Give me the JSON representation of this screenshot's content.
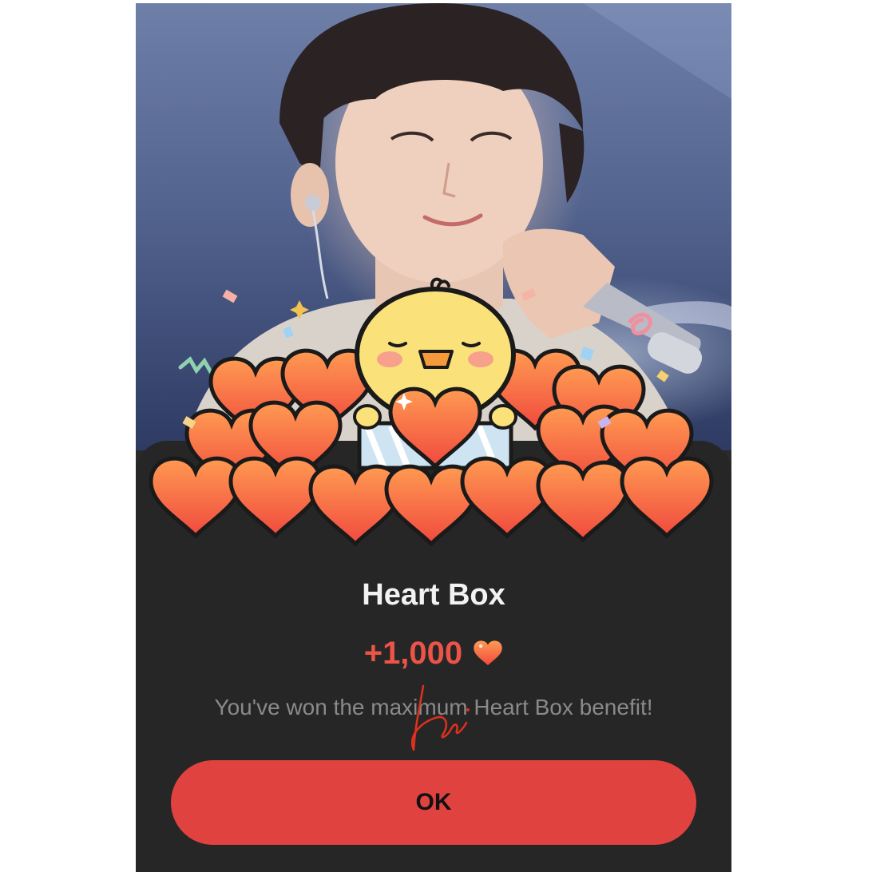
{
  "dialog": {
    "title": "Heart Box",
    "reward_amount": "+1,000",
    "message": "You've won the maximum Heart Box benefit!",
    "ok_label": "OK"
  },
  "icons": {
    "reward": "heart-icon",
    "character": "chick-mascot-illustration"
  },
  "colors": {
    "accent": "#e0433f",
    "reward_text": "#ec5448",
    "sheet_bg": "#262626",
    "title_text": "#f2f2f2",
    "message_text": "#8a8a8a"
  }
}
